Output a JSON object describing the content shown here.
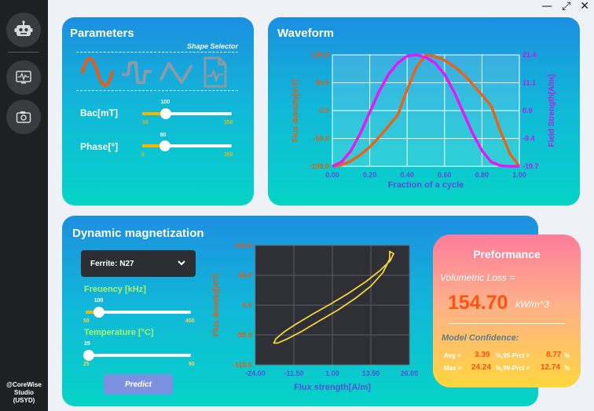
{
  "window_controls": {
    "minimize": "—",
    "maximize": "⤢",
    "close": "✕"
  },
  "sidebar": {
    "items": [
      {
        "name": "robot-icon"
      },
      {
        "name": "monitor-waveform-icon"
      },
      {
        "name": "camera-icon"
      }
    ],
    "brand_line1": "@CoreWise",
    "brand_line2": "Studio",
    "brand_line3": "(USYD)"
  },
  "parameters": {
    "title": "Parameters",
    "shape_selector_label": "Shape Selector",
    "shapes": [
      "sine-wave-icon",
      "trapezoid-wave-icon",
      "triangle-wave-icon",
      "custom-file-wave-icon"
    ],
    "selected_shape": "sine-wave-icon",
    "bac": {
      "label": "Bac[mT]",
      "value": "100",
      "min": "10",
      "max": "350",
      "fraction": 0.26
    },
    "phase": {
      "label": "Phase[°]",
      "value": "90",
      "min": "0",
      "max": "360",
      "fraction": 0.25
    }
  },
  "waveform": {
    "title": "Waveform",
    "chart_data": {
      "type": "line",
      "xlabel": "Fraction of a cycle",
      "ylabel_left": "Flux density[mT]",
      "ylabel_right": "Field Strength[A/m]",
      "x_ticks": [
        "0.00",
        "0.20",
        "0.40",
        "0.60",
        "0.80",
        "1.00"
      ],
      "y_left_ticks": [
        "100.0",
        "50.0",
        "0.0",
        "-50.0",
        "-100.0"
      ],
      "y_right_ticks": [
        "21.4",
        "11.1",
        "0.9",
        "-9.4",
        "-19.7"
      ],
      "xlim": [
        0,
        1
      ],
      "ylim_left": [
        -100,
        100
      ],
      "ylim_right": [
        -19.7,
        21.4
      ],
      "grid": true,
      "series": [
        {
          "color": "#e8641b",
          "x": [
            0.0,
            0.05,
            0.1,
            0.15,
            0.2,
            0.25,
            0.3,
            0.35,
            0.4,
            0.45,
            0.5,
            0.55,
            0.6,
            0.65,
            0.7,
            0.75,
            0.8,
            0.85,
            0.9,
            0.95,
            1.0
          ],
          "y": [
            -100,
            -97.6,
            -90.5,
            -79.4,
            -65.5,
            -47.6,
            -28.0,
            -8.0,
            38.0,
            78.0,
            100,
            97.6,
            90.5,
            79.4,
            65.5,
            47.6,
            28.0,
            8.0,
            -38.0,
            -78.0,
            -100
          ]
        },
        {
          "color": "#e619f5",
          "x": [
            0.0,
            0.05,
            0.1,
            0.15,
            0.2,
            0.25,
            0.3,
            0.35,
            0.4,
            0.45,
            0.5,
            0.55,
            0.6,
            0.65,
            0.7,
            0.75,
            0.8,
            0.85,
            0.9,
            0.95,
            1.0
          ],
          "y": [
            -19.7,
            -18.1,
            -13.9,
            -7.5,
            0.2,
            7.9,
            14.2,
            18.4,
            21.0,
            21.4,
            20.5,
            18.4,
            14.2,
            7.9,
            0.2,
            -7.5,
            -13.9,
            -18.1,
            -19.5,
            -19.7,
            -19.7
          ]
        }
      ]
    }
  },
  "dynamic": {
    "title": "Dynamic magnetization",
    "material_selected": "Ferrite: N27",
    "frequency": {
      "label": "Freuency [kHz]",
      "value": "100",
      "min": "50",
      "max": "450",
      "fraction": 0.125
    },
    "temperature": {
      "label": "Temperature [°C]",
      "value": "25",
      "min": "25",
      "max": "90",
      "fraction": 0.0
    },
    "predict_label": "Predict",
    "chart_data": {
      "type": "line",
      "xlabel": "Flux strength[A/m]",
      "ylabel": "Flux density[mT]",
      "x_ticks": [
        "-24.00",
        "-11.50",
        "1.00",
        "13.50",
        "26.00"
      ],
      "y_ticks": [
        "110.0",
        "55.0",
        "0.0",
        "-55.0",
        "-110.0"
      ],
      "xlim": [
        -24,
        26
      ],
      "ylim": [
        -110,
        110
      ],
      "grid": true,
      "series": [
        {
          "color": "#f5d33a",
          "x": [
            19.6,
            20.9,
            19.8,
            16.5,
            11.8,
            6.3,
            0.4,
            -5.5,
            -10.8,
            -14.8,
            -17.3,
            -18.0,
            -16.7,
            -13.5,
            -8.8,
            -3.2,
            2.8,
            8.6,
            13.5,
            17.4,
            19.6
          ],
          "y": [
            99,
            95,
            82,
            64,
            43,
            22,
            2,
            -17,
            -35,
            -50,
            -62,
            -70,
            -70,
            -62,
            -48,
            -29,
            -9,
            13,
            35,
            60,
            85
          ]
        }
      ]
    }
  },
  "performance": {
    "title": "Preformance",
    "volumetric_loss_label": "Volumetric Loss =",
    "volumetric_loss_value": "154.70",
    "volumetric_loss_unit": "kW/m^3",
    "model_confidence_label": "Model Confidence:",
    "avg_label": "Avg =",
    "avg_value": "3.39",
    "prct95_label": "%,95-Prct =",
    "prct95_value": "8.77",
    "max_label": "Max =",
    "max_value": "24.24",
    "prct99_label": "%,99-Prct =",
    "prct99_value": "12.74",
    "pct_suffix": "%"
  }
}
